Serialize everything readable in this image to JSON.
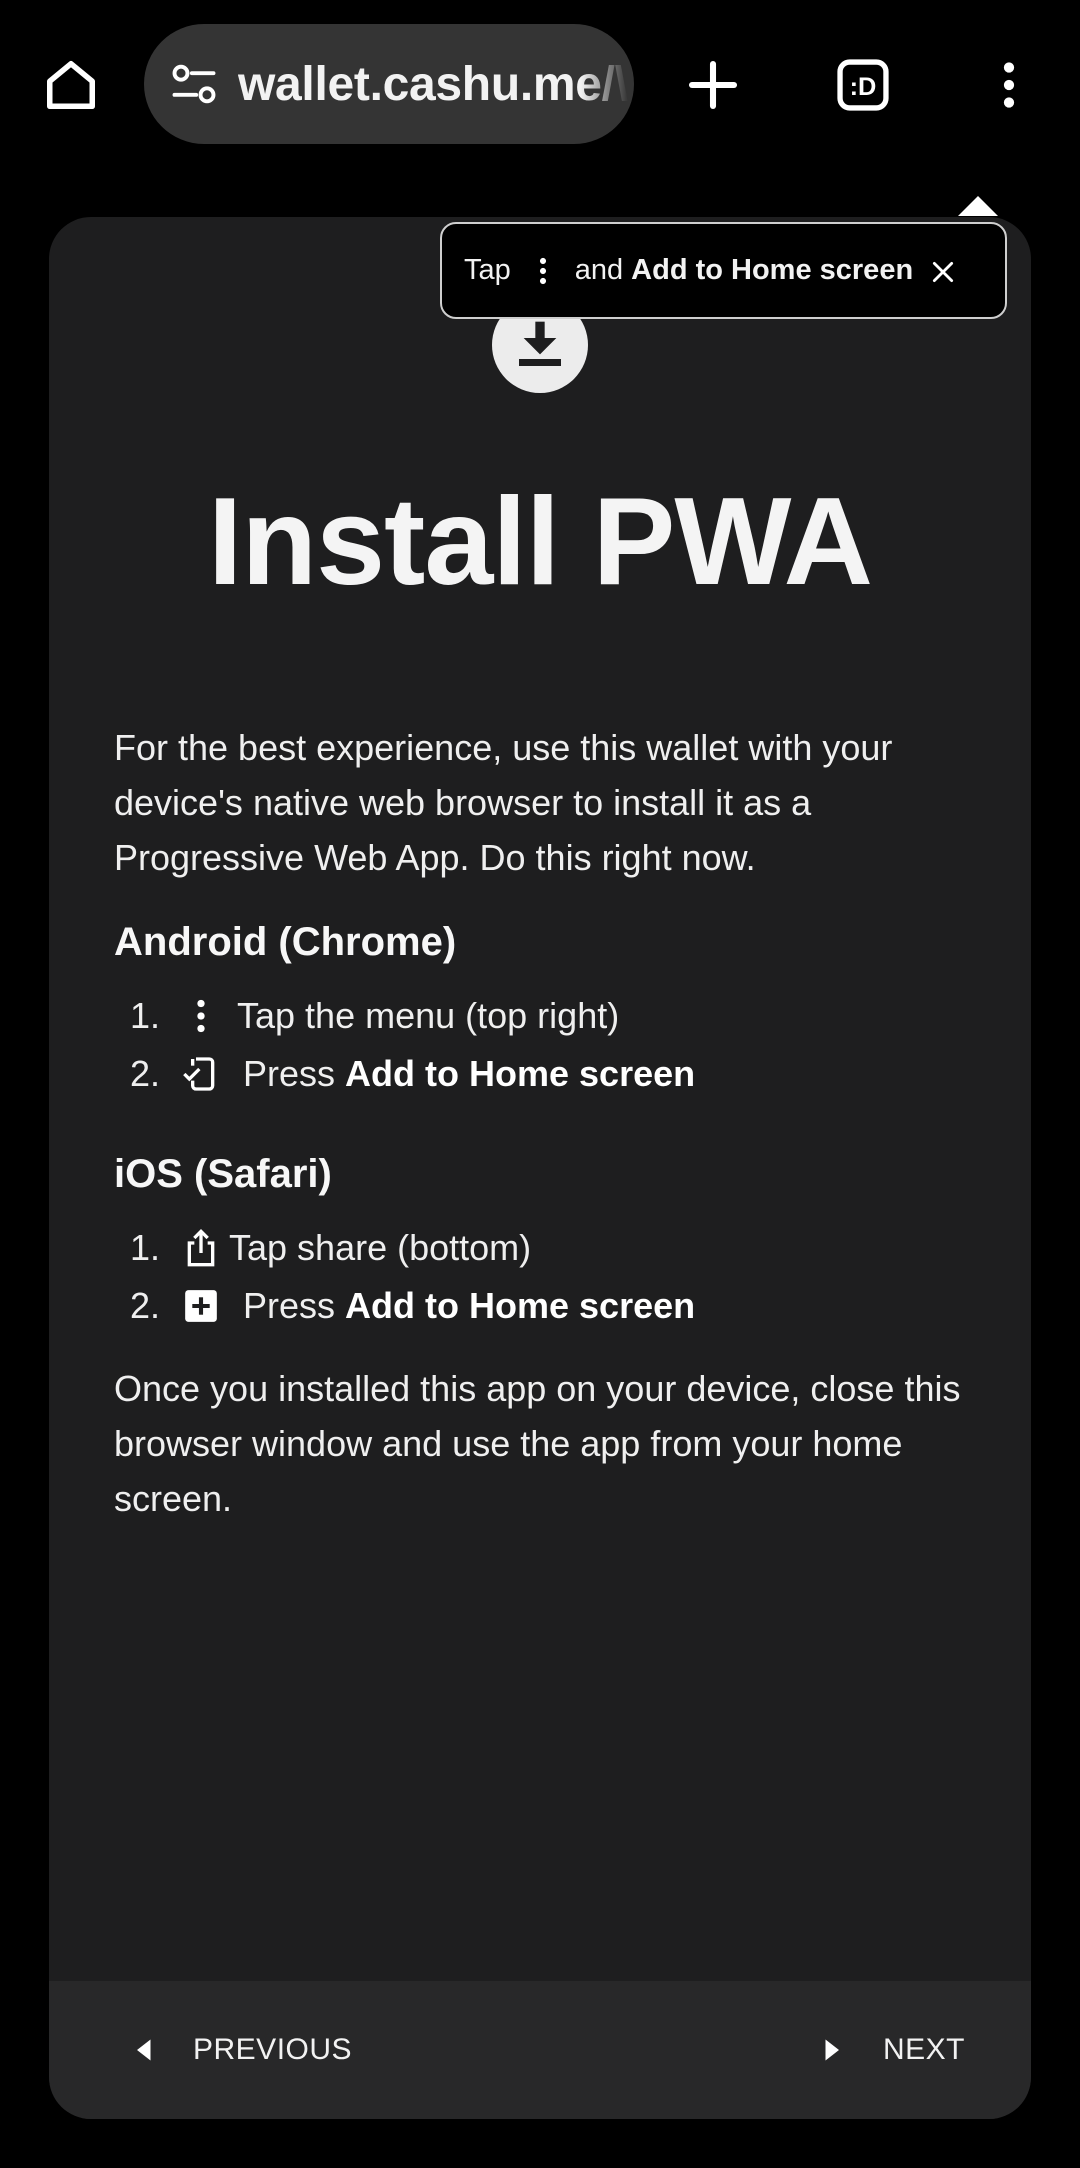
{
  "browser": {
    "url": "wallet.cashu.me/\\",
    "tab_count_label": ":D"
  },
  "hint": {
    "prefix": "Tap",
    "middle": "and",
    "action": "Add to Home screen"
  },
  "page": {
    "title": "Install PWA",
    "intro": "For the best experience, use this wallet with your device's native web browser to install it as a Progressive Web App. Do this right now.",
    "android": {
      "heading": "Android (Chrome)",
      "steps": [
        {
          "num": "1.",
          "text": "Tap the menu (top right)",
          "icon": "more-vert-icon"
        },
        {
          "num": "2.",
          "prefix": "Press",
          "bold": "Add to Home screen",
          "icon": "add-to-home-screen-icon"
        }
      ]
    },
    "ios": {
      "heading": "iOS (Safari)",
      "steps": [
        {
          "num": "1.",
          "text": "Tap share (bottom)",
          "icon": "ios-share-icon"
        },
        {
          "num": "2.",
          "prefix": "Press",
          "bold": "Add to Home screen",
          "icon": "add-box-icon"
        }
      ]
    },
    "outro": "Once you installed this app on your device, close this browser window and use the app from your home screen."
  },
  "footer": {
    "previous_label": "PREVIOUS",
    "next_label": "NEXT"
  },
  "colors": {
    "background": "#000000",
    "card": "#1e1e1f",
    "footer": "#282829",
    "urlbar": "#343434",
    "text": "#efefef"
  }
}
